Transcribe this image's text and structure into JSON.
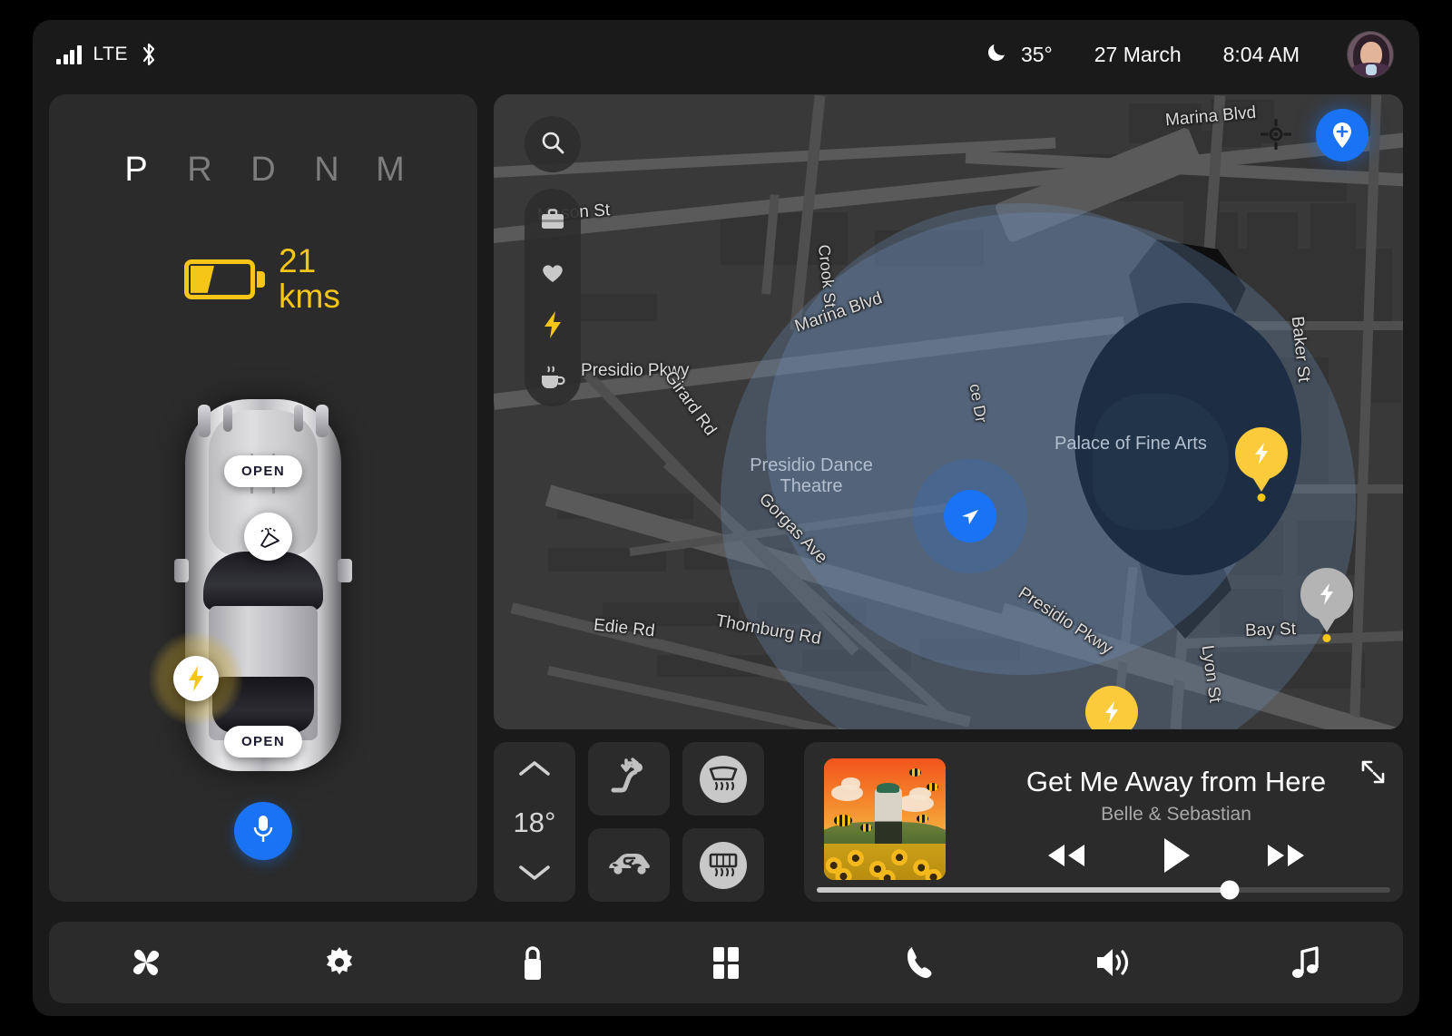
{
  "status_bar": {
    "network_label": "LTE",
    "bluetooth_icon": "bluetooth-icon",
    "signal_icon": "signal-bars-icon",
    "weather_icon": "moon-icon",
    "temperature": "35°",
    "date": "27 March",
    "time": "8:04 AM",
    "avatar": "user-avatar"
  },
  "car_panel": {
    "gears": [
      {
        "label": "P",
        "active": true
      },
      {
        "label": "R",
        "active": false
      },
      {
        "label": "D",
        "active": false
      },
      {
        "label": "N",
        "active": false
      },
      {
        "label": "M",
        "active": false
      }
    ],
    "battery": {
      "icon": "battery-icon",
      "range_value": "21",
      "range_unit": "kms",
      "color": "#f5c518"
    },
    "hood_badge": "OPEN",
    "trunk_badge": "OPEN",
    "wiper_icon": "windshield-wiper-icon",
    "charge_port_icon": "charging-bolt-icon",
    "voice_button_icon": "microphone-icon",
    "voice_button_color": "#1a73f5"
  },
  "map": {
    "search_icon": "search-icon",
    "tools": [
      {
        "name": "work-briefcase-icon",
        "active": false
      },
      {
        "name": "favorites-heart-icon",
        "active": false
      },
      {
        "name": "charging-bolt-icon",
        "active": true
      },
      {
        "name": "coffee-cup-icon",
        "active": false
      }
    ],
    "locate_icon": "locate-crosshair-icon",
    "add_pin_icon": "add-place-pin-icon",
    "add_pin_color": "#1a73f5",
    "position_marker_icon": "navigation-arrow-icon",
    "street_labels": [
      "Mason St",
      "Marina Blvd",
      "Marina Blvd",
      "Crook St",
      "Presidio Pkwy",
      "Girard Rd",
      "Gorgas Ave",
      "Thornburg Rd",
      "Edie Rd",
      "Presidio Pkwy",
      "Baker St",
      "Bay St",
      "Lyon St",
      "ce Dr"
    ],
    "poi_labels": [
      "Presidio Dance Theatre",
      "Palace of Fine Arts"
    ],
    "charging_pins": [
      {
        "type": "charging-station-pin",
        "state": "available",
        "color": "#fbcb3c"
      },
      {
        "type": "charging-station-pin",
        "state": "available",
        "color": "#fbcb3c"
      },
      {
        "type": "charging-station-pin",
        "state": "unavailable",
        "color": "#b4b4b4"
      }
    ]
  },
  "climate": {
    "temperature": "18°",
    "up_icon": "chevron-up-icon",
    "down_icon": "chevron-down-icon",
    "buttons": [
      {
        "name": "seat-airflow-icon",
        "active": false
      },
      {
        "name": "front-defrost-icon",
        "active": true
      },
      {
        "name": "air-recirculation-icon",
        "active": false
      },
      {
        "name": "rear-defrost-icon",
        "active": true
      }
    ]
  },
  "media": {
    "album_art": "album-artwork",
    "title": "Get Me Away from Here",
    "artist": "Belle & Sebastian",
    "previous_icon": "rewind-icon",
    "play_icon": "play-icon",
    "next_icon": "fast-forward-icon",
    "expand_icon": "expand-diagonal-icon",
    "progress_percent": 72
  },
  "bottom_nav": [
    {
      "name": "climate-fan-icon"
    },
    {
      "name": "settings-gear-icon"
    },
    {
      "name": "lock-icon"
    },
    {
      "name": "apps-grid-icon"
    },
    {
      "name": "phone-icon"
    },
    {
      "name": "volume-icon"
    },
    {
      "name": "music-note-icon"
    }
  ]
}
